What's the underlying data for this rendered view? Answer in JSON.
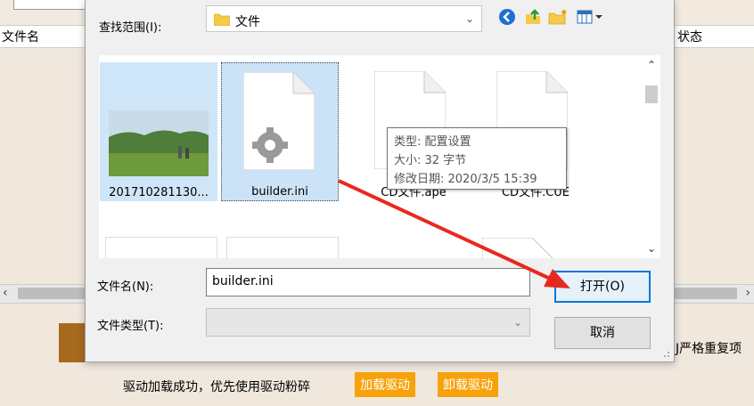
{
  "background": {
    "col_filename": "文件名",
    "col_status": "状态",
    "right_note": "J严格重复项",
    "status_text": "驱动加载成功，优先使用驱动粉碎",
    "load_driver_button": "加载驱动",
    "unload_driver_button": "卸载驱动",
    "accent_color": "#f7a20a"
  },
  "dialog": {
    "lookin_label": "查找范围(I):",
    "lookin_value": "文件",
    "toolbar_icons": [
      "back-icon",
      "up-folder-icon",
      "new-folder-icon",
      "view-menu-icon"
    ],
    "files": [
      {
        "name": "201710281130...",
        "icon": "photo-thumbnail"
      },
      {
        "name": "builder.ini",
        "icon": "settings-file-icon",
        "selected": true
      },
      {
        "name": "CD文件.ape",
        "icon": "generic-file-icon"
      },
      {
        "name": "CD文件.CUE",
        "icon": "generic-file-icon"
      }
    ],
    "tooltip": {
      "type": "类型: 配置设置",
      "size": "大小: 32 字节",
      "modified": "修改日期: 2020/3/5 15:39"
    },
    "filename_label": "文件名(N):",
    "filename_value": "builder.ini",
    "filetype_label": "文件类型(T):",
    "filetype_value": "",
    "open_button": "打开(O)",
    "cancel_button": "取消",
    "annotation_arrow_color": "#e8281f"
  }
}
